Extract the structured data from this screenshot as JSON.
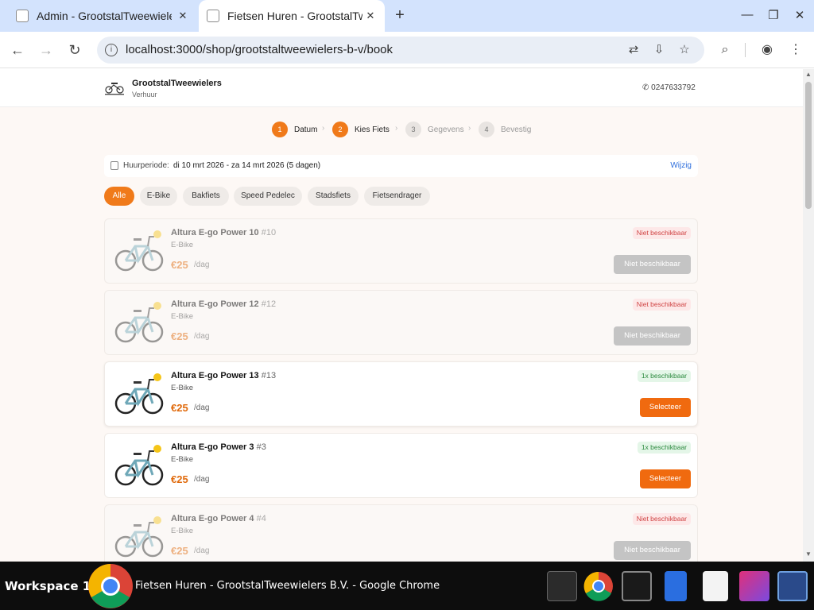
{
  "browser": {
    "tabs": [
      {
        "title": "Admin - GrootstalTweewielers"
      },
      {
        "title": "Fietsen Huren - GrootstalTweewielers"
      }
    ],
    "url": "localhost:3000/shop/grootstaltweewielers-b-v/book"
  },
  "site": {
    "brand": "GrootstalTweewielers",
    "subtitle": "Verhuur",
    "phone": "0247633792"
  },
  "steps": [
    {
      "num": "1",
      "label": "Datum"
    },
    {
      "num": "2",
      "label": "Kies Fiets"
    },
    {
      "num": "3",
      "label": "Gegevens"
    },
    {
      "num": "4",
      "label": "Bevestig"
    }
  ],
  "period": {
    "label": "Huurperiode:",
    "value": "di 10 mrt 2026 - za 14 mrt 2026 (5 dagen)",
    "edit": "Wijzig"
  },
  "filters": [
    "Alle",
    "E-Bike",
    "Bakfiets",
    "Speed Pedelec",
    "Stadsfiets",
    "Fietsendrager"
  ],
  "bikes": [
    {
      "name": "Altura E-go Power 10",
      "num": "#10",
      "category": "E-Bike",
      "price": "€25",
      "per": "/dag",
      "status": "Niet beschikbaar",
      "button": "Niet beschikbaar"
    },
    {
      "name": "Altura E-go Power 12",
      "num": "#12",
      "category": "E-Bike",
      "price": "€25",
      "per": "/dag",
      "status": "Niet beschikbaar",
      "button": "Niet beschikbaar"
    },
    {
      "name": "Altura E-go Power 13",
      "num": "#13",
      "category": "E-Bike",
      "price": "€25",
      "per": "/dag",
      "status": "1x beschikbaar",
      "button": "Selecteer"
    },
    {
      "name": "Altura E-go Power 3",
      "num": "#3",
      "category": "E-Bike",
      "price": "€25",
      "per": "/dag",
      "status": "1x beschikbaar",
      "button": "Selecteer"
    },
    {
      "name": "Altura E-go Power 4",
      "num": "#4",
      "category": "E-Bike",
      "price": "€25",
      "per": "/dag",
      "status": "Niet beschikbaar",
      "button": "Niet beschikbaar"
    }
  ],
  "taskbar": {
    "workspace": "Workspace 1",
    "window_title": "Fietsen Huren - GrootstalTweewielers B.V. - Google Chrome"
  }
}
